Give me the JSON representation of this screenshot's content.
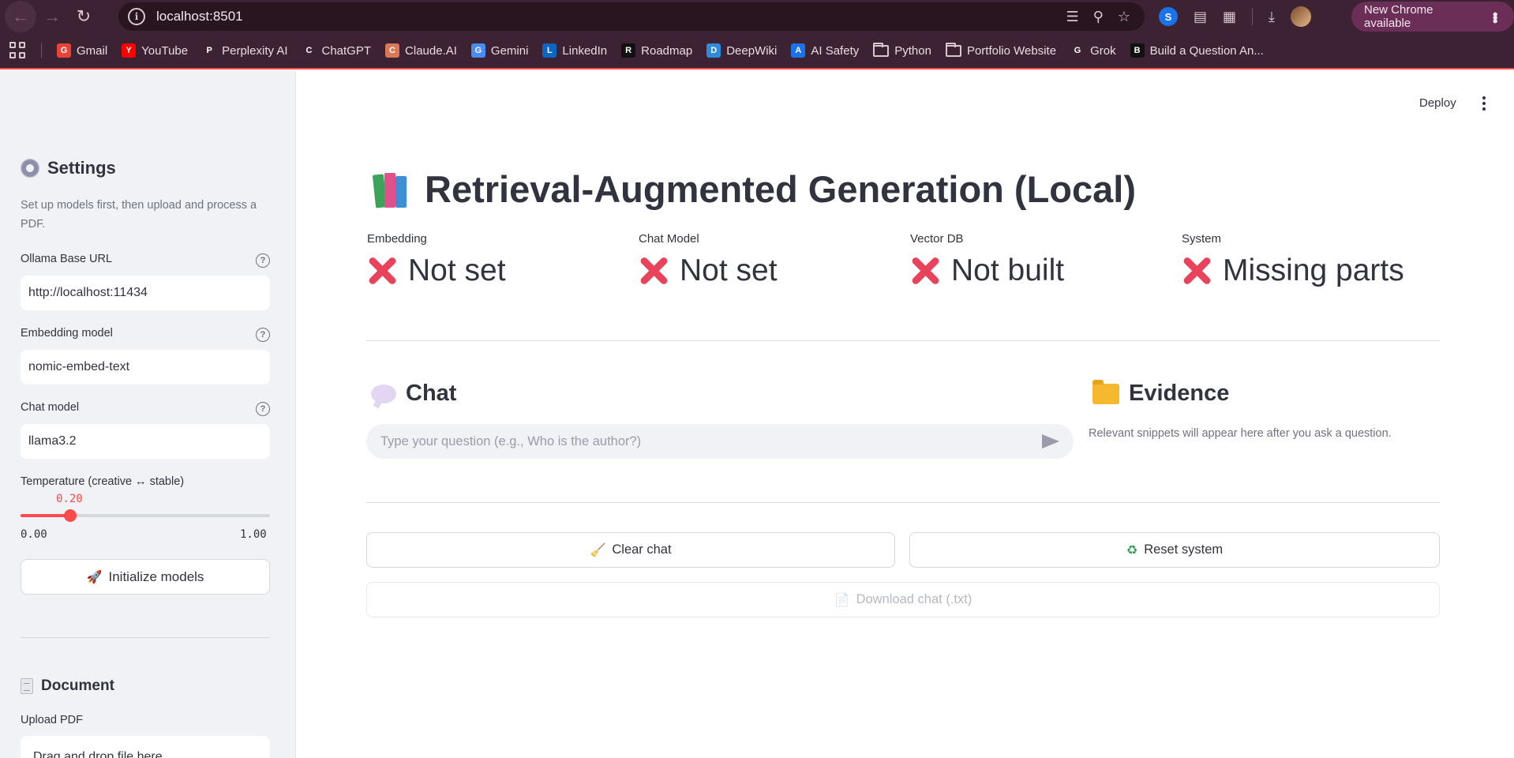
{
  "browser": {
    "url": "localhost:8501",
    "update_label": "New Chrome available",
    "bookmarks": [
      {
        "label": "Gmail",
        "icon": "gmail-icon",
        "color": "#ea4335"
      },
      {
        "label": "YouTube",
        "icon": "youtube-icon",
        "color": "#ff0000"
      },
      {
        "label": "Perplexity AI",
        "icon": "perplexity-icon",
        "color": "#3c2232"
      },
      {
        "label": "ChatGPT",
        "icon": "chatgpt-icon",
        "color": "#3c2232"
      },
      {
        "label": "Claude.AI",
        "icon": "claude-icon",
        "color": "#d97757"
      },
      {
        "label": "Gemini",
        "icon": "gemini-icon",
        "color": "#4a8cf7"
      },
      {
        "label": "LinkedIn",
        "icon": "linkedin-icon",
        "color": "#0a66c2"
      },
      {
        "label": "Roadmap",
        "icon": "roadmap-icon",
        "color": "#111111"
      },
      {
        "label": "DeepWiki",
        "icon": "deepwiki-icon",
        "color": "#2f8cdc"
      },
      {
        "label": "AI Safety",
        "icon": "ai-safety-icon",
        "color": "#1a73e8"
      },
      {
        "label": "Python",
        "icon": "folder-icon",
        "color": ""
      },
      {
        "label": "Portfolio Website",
        "icon": "folder-icon",
        "color": ""
      },
      {
        "label": "Grok",
        "icon": "grok-icon",
        "color": "#3c2232"
      },
      {
        "label": "Build a Question An...",
        "icon": "build-icon",
        "color": "#111111"
      }
    ]
  },
  "sidebar": {
    "title": "Settings",
    "description": "Set up models first, then upload and process a PDF.",
    "ollama_label": "Ollama Base URL",
    "ollama_value": "http://localhost:11434",
    "embedding_label": "Embedding model",
    "embedding_value": "nomic-embed-text",
    "chat_label": "Chat model",
    "chat_value": "llama3.2",
    "temperature_label": "Temperature (creative ↔ stable)",
    "temperature_value": "0.20",
    "temperature_fraction": 0.2,
    "temperature_min": "0.00",
    "temperature_max": "1.00",
    "init_button": "Initialize models",
    "document_title": "Document",
    "upload_label": "Upload PDF",
    "upload_text": "Drag and drop file here"
  },
  "header": {
    "deploy": "Deploy"
  },
  "main": {
    "title": "Retrieval-Augmented Generation (Local)",
    "metrics": [
      {
        "label": "Embedding",
        "value": "Not set"
      },
      {
        "label": "Chat Model",
        "value": "Not set"
      },
      {
        "label": "Vector DB",
        "value": "Not built"
      },
      {
        "label": "System",
        "value": "Missing parts"
      }
    ],
    "chat_title": "Chat",
    "chat_placeholder": "Type your question (e.g., Who is the author?)",
    "evidence_title": "Evidence",
    "evidence_note": "Relevant snippets will appear here after you ask a question.",
    "clear_chat": "Clear chat",
    "reset_system": "Reset system",
    "download_chat": "Download chat (.txt)"
  },
  "colors": {
    "accent": "#ff4b4b",
    "error": "#e8435a",
    "chrome_frame": "#3c2232"
  }
}
